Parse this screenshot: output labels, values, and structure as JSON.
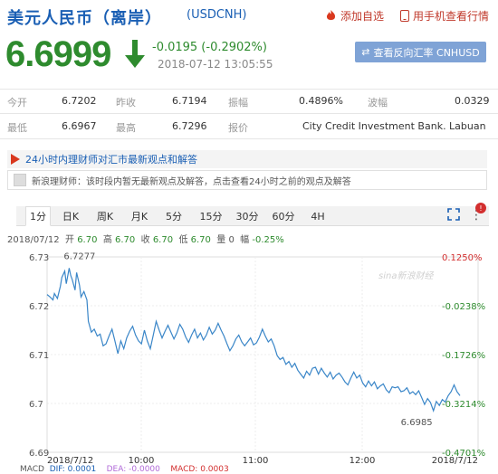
{
  "header": {
    "title": "美元人民币（离岸）",
    "symbol": "(USDCNH)",
    "favorite_label": "添加自选",
    "mobile_label": "用手机查看行情",
    "price": "6.6999",
    "change": "-0.0195 (-0.2902%)",
    "timestamp": "2018-07-12 13:05:55",
    "reverse_button": "查看反向汇率 CNHUSD"
  },
  "stats": {
    "row1": [
      {
        "label": "今开",
        "value": "6.7202"
      },
      {
        "label": "昨收",
        "value": "6.7194"
      },
      {
        "label": "振幅",
        "value": "0.4896%"
      },
      {
        "label": "波幅",
        "value": "0.0329"
      }
    ],
    "row2": [
      {
        "label": "最低",
        "value": "6.6967"
      },
      {
        "label": "最高",
        "value": "6.7296"
      },
      {
        "label": "报价",
        "value": "City Credit Investment Bank. Labuan"
      }
    ]
  },
  "news": {
    "header": "24小时内理财师对汇市最新观点和解答",
    "message": "新浪理财师：该时段内暂无最新观点及解答，点击查看24小时之前的观点及解答"
  },
  "tabs": [
    "1分",
    "日K",
    "周K",
    "月K",
    "5分",
    "15分",
    "30分",
    "60分",
    "4H"
  ],
  "badge": "!",
  "ohlc": {
    "date": "2018/07/12",
    "open_label": "开",
    "open": "6.70",
    "high_label": "高",
    "high": "6.70",
    "close_label": "收",
    "close": "6.70",
    "low_label": "低",
    "low": "6.70",
    "vol_label": "量",
    "vol": "0",
    "amp_label": "幅",
    "amp": "-0.25%"
  },
  "watermark": "sina新浪财经",
  "macd": {
    "label": "MACD",
    "dif": "DIF: 0.0001",
    "dea": "DEA: -0.0000",
    "macd": "MACD: 0.0003"
  },
  "chart_data": {
    "type": "line",
    "x_tick_labels": [
      "2018/7/12",
      "10:00",
      "11:00",
      "12:00",
      "2018/7/12"
    ],
    "y_left_ticks": [
      "6.73",
      "6.72",
      "6.71",
      "6.7",
      "6.69"
    ],
    "y_right_ticks": [
      "0.1250%",
      "-0.0238%",
      "-0.1726%",
      "-0.3214%",
      "-0.4701%"
    ],
    "ylim": [
      6.69,
      6.73
    ],
    "annotations": [
      {
        "label": "6.7277"
      },
      {
        "label": "6.6985"
      }
    ],
    "colors": {
      "line": "#3a86c8",
      "positive": "#d32f2f",
      "negative": "#2e8b2e"
    },
    "series": [
      {
        "x": [
          0,
          2,
          4,
          5,
          7,
          9,
          10,
          12,
          13,
          15,
          16,
          17,
          19,
          20,
          22,
          23,
          25,
          27,
          28,
          30,
          32,
          34,
          36,
          38,
          40,
          42,
          44,
          46,
          48,
          50,
          52,
          54,
          56,
          58,
          60,
          62,
          64,
          66,
          68,
          70,
          72,
          74,
          76,
          78,
          80,
          82,
          84,
          86,
          88,
          90,
          92,
          94,
          96,
          98,
          100,
          102,
          104,
          106,
          108,
          110,
          112,
          114,
          116,
          118,
          120,
          122,
          124,
          126,
          128,
          130,
          132,
          134,
          136,
          138,
          140,
          142,
          144,
          146,
          148,
          150,
          152,
          154,
          156,
          158,
          160,
          162,
          164,
          166,
          168,
          170,
          172,
          174,
          176,
          178,
          180,
          182,
          184,
          186,
          188,
          190,
          192,
          194,
          196,
          198,
          200,
          202,
          204,
          206,
          208,
          210,
          212,
          214,
          216,
          218,
          220,
          222,
          224,
          226,
          228,
          230,
          232,
          234,
          236,
          238,
          240,
          242,
          244,
          246,
          248,
          250,
          252,
          254,
          256,
          258,
          260,
          262,
          264,
          266,
          268,
          270,
          272,
          274,
          276,
          278,
          280
        ],
        "values": [
          6.7223,
          6.7218,
          6.7212,
          6.7225,
          6.7215,
          6.724,
          6.7258,
          6.7271,
          6.7245,
          6.7277,
          6.7262,
          6.7254,
          6.7232,
          6.7268,
          6.7242,
          6.7218,
          6.7229,
          6.7212,
          6.7168,
          6.7146,
          6.7152,
          6.7138,
          6.7142,
          6.7118,
          6.7122,
          6.7138,
          6.7152,
          6.7128,
          6.7102,
          6.7128,
          6.7112,
          6.7134,
          6.7148,
          6.7158,
          6.714,
          6.7128,
          6.7122,
          6.715,
          6.7128,
          6.7112,
          6.714,
          6.7168,
          6.715,
          6.7134,
          6.7148,
          6.716,
          6.7146,
          6.7132,
          6.7144,
          6.7162,
          6.7152,
          6.7136,
          6.7125,
          6.714,
          6.7152,
          6.7134,
          6.7144,
          6.713,
          6.714,
          6.7156,
          6.7142,
          6.715,
          6.7164,
          6.715,
          6.7138,
          6.7122,
          6.7108,
          6.7118,
          6.7132,
          6.714,
          6.7126,
          6.7118,
          6.7126,
          6.7134,
          6.712,
          6.7124,
          6.7136,
          6.7152,
          6.7138,
          6.7126,
          6.7132,
          6.7118,
          6.7098,
          6.709,
          6.7094,
          6.708,
          6.7086,
          6.7074,
          6.7082,
          6.7068,
          6.706,
          6.7052,
          6.7066,
          6.7058,
          6.7072,
          6.7074,
          6.706,
          6.7072,
          6.7062,
          6.7054,
          6.7064,
          6.705,
          6.7058,
          6.7062,
          6.7054,
          6.7044,
          6.7038,
          6.7052,
          6.7064,
          6.7052,
          6.7058,
          6.7042,
          6.7034,
          6.7046,
          6.7036,
          6.7044,
          6.703,
          6.7036,
          6.704,
          6.7028,
          6.7022,
          6.7034,
          6.7032,
          6.7034,
          6.7024,
          6.7026,
          6.7032,
          6.702,
          6.7024,
          6.7018,
          6.7026,
          6.7012,
          6.6998,
          6.701,
          6.7002,
          6.6985,
          6.7004,
          6.6996,
          6.7008,
          6.7003,
          6.7016,
          6.7024,
          6.7038,
          6.7024,
          6.7016
        ]
      }
    ]
  }
}
